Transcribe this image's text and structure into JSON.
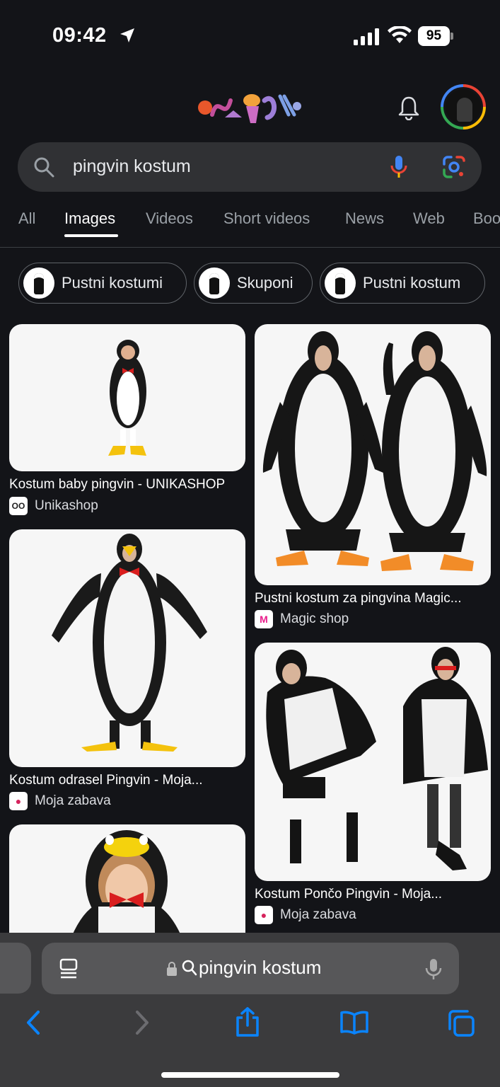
{
  "status_bar": {
    "time": "09:42",
    "battery": "95"
  },
  "search": {
    "query": "pingvin kostum"
  },
  "tabs": [
    {
      "label": "All",
      "active": false
    },
    {
      "label": "Images",
      "active": true
    },
    {
      "label": "Videos",
      "active": false
    },
    {
      "label": "Short videos",
      "active": false
    },
    {
      "label": "News",
      "active": false
    },
    {
      "label": "Web",
      "active": false
    },
    {
      "label": "Boo",
      "active": false
    }
  ],
  "chips": [
    {
      "label": "Pustni kostumi"
    },
    {
      "label": "Skuponi"
    },
    {
      "label": "Pustni kostum"
    }
  ],
  "results": [
    {
      "title": "Kostum baby pingvin - UNIKASHOP",
      "source": "Unikashop",
      "favicon": "OO"
    },
    {
      "title": "Pustni kostum za pingvina Magic...",
      "source": "Magic shop",
      "favicon": "M"
    },
    {
      "title": "Kostum odrasel Pingvin - Moja...",
      "source": "Moja zabava",
      "favicon": "●"
    },
    {
      "title": "Kostum Pončo Pingvin - Moja...",
      "source": "Moja zabava",
      "favicon": "●"
    }
  ],
  "browser": {
    "url_text": "pingvin kostum"
  },
  "colors": {
    "background": "#131418",
    "search_bar": "#303134",
    "browser_panel": "#3b3b3d",
    "ios_blue": "#0a84ff"
  }
}
